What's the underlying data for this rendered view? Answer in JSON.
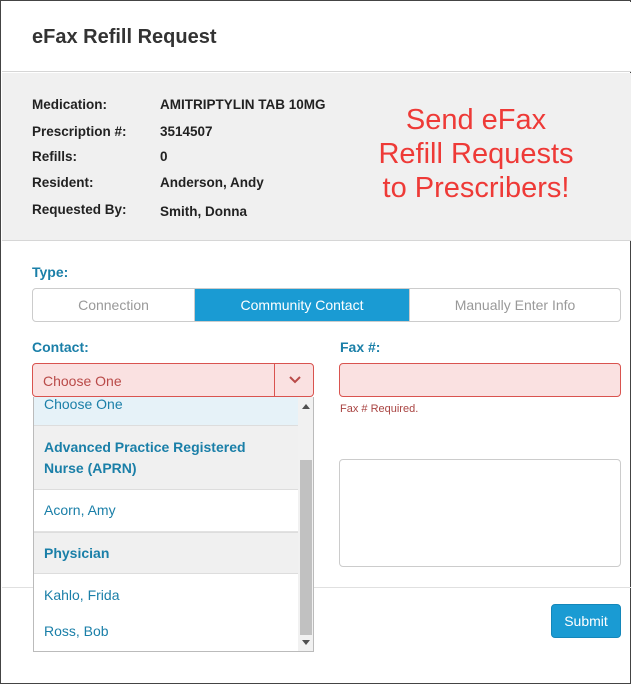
{
  "header": {
    "title": "eFax Refill Request"
  },
  "info": {
    "medication_label": "Medication:",
    "medication_value": "AMITRIPTYLIN TAB 10MG",
    "prescription_label": "Prescription #:",
    "prescription_value": "3514507",
    "refills_label": "Refills:",
    "refills_value": "0",
    "resident_label": "Resident:",
    "resident_value": "Anderson, Andy",
    "requested_by_label": "Requested By:",
    "requested_by_value": "Smith, Donna"
  },
  "promo": {
    "line1": "Send eFax",
    "line2": "Refill Requests",
    "line3": "to Prescribers!"
  },
  "type": {
    "label": "Type:",
    "options": [
      "Connection",
      "Community Contact",
      "Manually Enter Info"
    ],
    "selected": "Community Contact"
  },
  "contact": {
    "label": "Contact:",
    "value": "Choose One",
    "dropdown": {
      "choose_one": "Choose One",
      "group1": "Advanced Practice Registered Nurse (APRN)",
      "group1_items": [
        "Acorn, Amy"
      ],
      "group2": "Physician",
      "group2_items": [
        "Kahlo, Frida",
        "Ross, Bob"
      ]
    }
  },
  "fax": {
    "label": "Fax #:",
    "value": "",
    "error": "Fax # Required."
  },
  "notes": {
    "value": ""
  },
  "footer": {
    "submit_label": "Submit"
  },
  "colors": {
    "accent": "#1a9bd3",
    "label_blue": "#1a7fa8",
    "error_red": "#d9534f",
    "error_bg": "#fae1e1",
    "promo_red": "#ee3a37"
  }
}
